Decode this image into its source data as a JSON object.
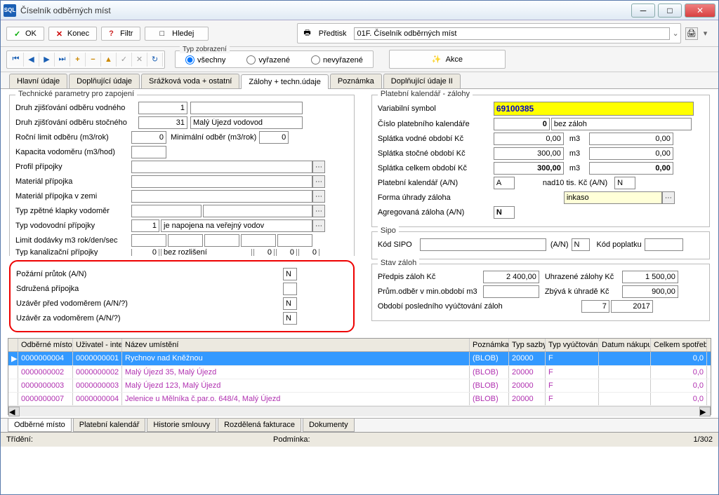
{
  "title": "Číselník odběrných míst",
  "toolbar": {
    "ok": "OK",
    "konec": "Konec",
    "filtr": "Filtr",
    "hledej": "Hledej",
    "predtisk": "Předtisk",
    "predtisk_sel": "01F. Číselník odběrných míst"
  },
  "typzobr": {
    "legend": "Typ zobrazení",
    "vsechny": "všechny",
    "vyrazene": "vyřazené",
    "nevyrazene": "nevyřazené"
  },
  "akce": "Akce",
  "tabs": {
    "hlavni": "Hlavní údaje",
    "doplnujici": "Doplňující údaje",
    "srazkova": "Srážková voda + ostatní",
    "zalohy": "Zálohy + techn.údaje",
    "poznamka": "Poznámka",
    "dopl2": "Doplňující údaje II"
  },
  "tech": {
    "legend": "Technické parametry pro zapojení",
    "druh_vodne_l": "Druh zjišťování odběru vodného",
    "druh_vodne_v": "1",
    "druh_stocne_l": "Druh zjišťování odběru stočného",
    "druh_stocne_v": "31",
    "druh_stocne_t": "Malý Újezd vodovod",
    "rocni_l": "Roční limit odběru (m3/rok)",
    "rocni_v": "0",
    "min_odb_l": "Minimální odběr (m3/rok)",
    "min_odb_v": "0",
    "kapacita_l": "Kapacita vodoměru (m3/hod)",
    "profil_l": "Profil přípojky",
    "material_l": "Materiál přípojka",
    "material_zemi_l": "Materiál přípojka v zemi",
    "zpetna_l": "Typ zpětné klapky vodoměr",
    "vodov_l": "Typ vodovodní přípojky",
    "vodov_v": "1",
    "vodov_t": "je napojena na veřejný vodov",
    "limit_l": "Limit dodávky m3 rok/den/sec",
    "limit_1": "0",
    "limit_t": "bez rozlišení",
    "limit_2": "0",
    "limit_3": "0",
    "limit_4": "0",
    "kanal_l": "Typ kanalizační přípojky",
    "pozarni_l": "Požární průtok (A/N)",
    "pozarni_v": "N",
    "sdruzena_l": "Sdružená přípojka",
    "uzaver_pred_l": "Uzávěr před vodoměrem (A/N/?)",
    "uzaver_pred_v": "N",
    "uzaver_za_l": "Uzávěr za vodoměrem (A/N/?)",
    "uzaver_za_v": "N"
  },
  "plat": {
    "legend": "Platební kalendář - zálohy",
    "var_l": "Variabilní symbol",
    "var_v": "69100385",
    "cislo_l": "Číslo platebního kalendáře",
    "cislo_v": "0",
    "cislo_t": "bez záloh",
    "spl_vod_l": "Splátka vodné období Kč",
    "spl_vod_v": "0,00",
    "m3": "m3",
    "m3_vod": "0,00",
    "spl_sto_l": "Splátka stočné období Kč",
    "spl_sto_v": "300,00",
    "m3_sto": "0,00",
    "spl_celk_l": "Splátka celkem období Kč",
    "spl_celk_v": "300,00",
    "m3_celk": "0,00",
    "plat_kal_l": "Platební kalendář  (A/N)",
    "plat_kal_v": "A",
    "nad10_l": "nad10 tis. Kč (A/N)",
    "nad10_v": "N",
    "forma_l": "Forma úhrady záloha",
    "forma_v": "inkaso",
    "agreg_l": "Agregovaná záloha (A/N)",
    "agreg_v": "N"
  },
  "sipo": {
    "legend": "Sipo",
    "kod_l": "Kód SIPO",
    "an_l": "(A/N)",
    "an_v": "N",
    "poplatek_l": "Kód poplatku"
  },
  "stav": {
    "legend": "Stav záloh",
    "predpis_l": "Předpis záloh Kč",
    "predpis_v": "2 400,00",
    "uhrazene_l": "Uhrazené zálohy Kč",
    "uhrazene_v": "1 500,00",
    "prum_l": "Prům.odběr v min.období m3",
    "prum_v": "",
    "zbyva_l": "Zbývá k úhradě Kč",
    "zbyva_v": "900,00",
    "obdobi_l": "Období posledního vyúčtování záloh",
    "obdobi_1": "7",
    "obdobi_2": "2017"
  },
  "grid": {
    "cols": {
      "odb": "Odběrné místo",
      "uziv": "Uživatel - inter",
      "nazev": "Název umístění",
      "pozn": "Poznámka",
      "sazba": "Typ sazby",
      "vyuct": "Typ vyúčtování",
      "datum": "Datum nákupu",
      "celkem": "Celkem spotřeba vod"
    },
    "rows": [
      {
        "odb": "0000000004",
        "uziv": "0000000001",
        "nazev": "Rychnov nad Kněžnou",
        "pozn": "(BLOB)",
        "sazba": "20000",
        "vyuct": "F",
        "celkem": "0,0"
      },
      {
        "odb": "0000000002",
        "uziv": "0000000002",
        "nazev": "Malý Újezd 35, Malý Újezd",
        "pozn": "(BLOB)",
        "sazba": "20000",
        "vyuct": "F",
        "celkem": "0,0"
      },
      {
        "odb": "0000000003",
        "uziv": "0000000003",
        "nazev": "Malý Újezd 123, Malý Újezd",
        "pozn": "(BLOB)",
        "sazba": "20000",
        "vyuct": "F",
        "celkem": "0,0"
      },
      {
        "odb": "0000000007",
        "uziv": "0000000004",
        "nazev": "Jelenice u Mělníka č.par.o. 648/4, Malý Újezd",
        "pozn": "(BLOB)",
        "sazba": "20000",
        "vyuct": "F",
        "celkem": "0,0"
      }
    ]
  },
  "btabs": {
    "odb": "Odběrné místo",
    "plat": "Platební kalendář",
    "hist": "Historie smlouvy",
    "rozd": "Rozdělená fakturace",
    "dok": "Dokumenty"
  },
  "status": {
    "trideni": "Třídění:",
    "podminka": "Podmínka:",
    "count": "1/302"
  }
}
